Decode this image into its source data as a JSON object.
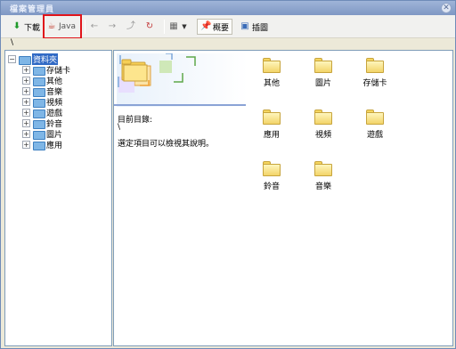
{
  "window": {
    "title": "檔案管理員",
    "close_symbol": "✕"
  },
  "toolbar": {
    "download_label": "下載",
    "java_label": "Java",
    "back_symbol": "←",
    "forward_symbol": "→",
    "summary_label": "概要",
    "thumbnail_label": "插圖"
  },
  "path": {
    "current": "\\"
  },
  "tree": {
    "root_label": "資料夾",
    "items": [
      {
        "label": "存儲卡"
      },
      {
        "label": "其他"
      },
      {
        "label": "音樂"
      },
      {
        "label": "視頻"
      },
      {
        "label": "遊戲"
      },
      {
        "label": "鈴音"
      },
      {
        "label": "圖片"
      },
      {
        "label": "應用"
      }
    ]
  },
  "details": {
    "dir_label": "目前目錄:",
    "dir_value": "\\",
    "hint": "選定項目可以檢視其說明。"
  },
  "files": [
    {
      "label": "其他"
    },
    {
      "label": "圖片"
    },
    {
      "label": "存儲卡"
    },
    {
      "label": "應用"
    },
    {
      "label": "視頻"
    },
    {
      "label": "遊戲"
    },
    {
      "label": "鈴音"
    },
    {
      "label": "音樂"
    }
  ]
}
